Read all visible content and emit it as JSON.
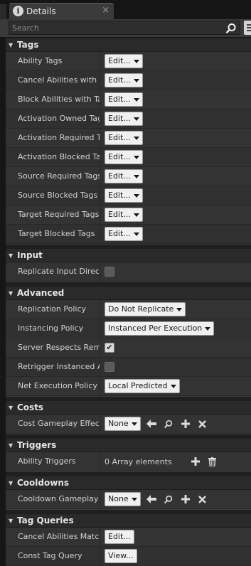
{
  "tab": {
    "title": "Details",
    "close": "×"
  },
  "search": {
    "placeholder": "Search"
  },
  "sections": {
    "tags": {
      "title": "Tags",
      "rows": [
        {
          "label": "Ability Tags",
          "button": "Edit..."
        },
        {
          "label": "Cancel Abilities with Tag",
          "button": "Edit..."
        },
        {
          "label": "Block Abilities with Tag",
          "button": "Edit..."
        },
        {
          "label": "Activation Owned Tags",
          "button": "Edit..."
        },
        {
          "label": "Activation Required Tags",
          "button": "Edit..."
        },
        {
          "label": "Activation Blocked Tags",
          "button": "Edit..."
        },
        {
          "label": "Source Required Tags",
          "button": "Edit..."
        },
        {
          "label": "Source Blocked Tags",
          "button": "Edit..."
        },
        {
          "label": "Target Required Tags",
          "button": "Edit..."
        },
        {
          "label": "Target Blocked Tags",
          "button": "Edit..."
        }
      ]
    },
    "input": {
      "title": "Input",
      "replicate_label": "Replicate Input Directly",
      "replicate_checked": false
    },
    "advanced": {
      "title": "Advanced",
      "replication_label": "Replication Policy",
      "replication_value": "Do Not Replicate",
      "instancing_label": "Instancing Policy",
      "instancing_value": "Instanced Per Execution",
      "server_respects_label": "Server Respects Remote Ability Cancellation",
      "server_respects_checked": true,
      "retrigger_label": "Retrigger Instanced Ability",
      "retrigger_checked": false,
      "net_exec_label": "Net Execution Policy",
      "net_exec_value": "Local Predicted"
    },
    "costs": {
      "title": "Costs",
      "label": "Cost Gameplay Effect Class",
      "value": "None"
    },
    "triggers": {
      "title": "Triggers",
      "label": "Ability Triggers",
      "value": "0 Array elements"
    },
    "cooldowns": {
      "title": "Cooldowns",
      "label": "Cooldown Gameplay Effect Class",
      "value": "None"
    },
    "tag_queries": {
      "title": "Tag Queries",
      "cancel_label": "Cancel Abilities Matching Tag Query",
      "cancel_button": "Edit...",
      "const_label": "Const Tag Query",
      "const_button": "View..."
    }
  },
  "icons": {
    "collapse": "▼",
    "check": "✔",
    "use_selected": "arrow-left-icon",
    "browse": "search-icon",
    "add": "plus-icon",
    "clear": "close-icon",
    "remove_all": "trash-icon"
  }
}
